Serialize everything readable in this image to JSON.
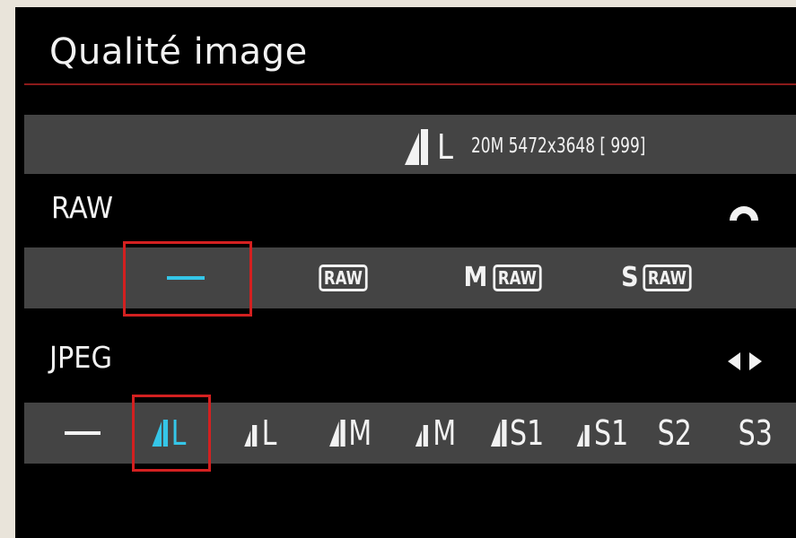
{
  "title": "Qualité image",
  "info": {
    "quality_icon": "fine-quality-icon",
    "size": "L",
    "text": "20M 5472x3648 [ 999]"
  },
  "raw": {
    "label": "RAW",
    "control_icon": "main-dial-icon",
    "options": [
      {
        "label": "—",
        "selected": true
      },
      {
        "label": "RAW",
        "prefix": ""
      },
      {
        "label": "RAW",
        "prefix": "M"
      },
      {
        "label": "RAW",
        "prefix": "S"
      }
    ]
  },
  "jpeg": {
    "label": "JPEG",
    "control_icon": "left-right-arrows-icon",
    "options": [
      {
        "label": "—"
      },
      {
        "label": "L",
        "icon": "fine-quality-icon",
        "selected": true
      },
      {
        "label": "L",
        "icon": "normal-quality-icon"
      },
      {
        "label": "M",
        "icon": "fine-quality-icon"
      },
      {
        "label": "M",
        "icon": "normal-quality-icon"
      },
      {
        "label": "S1",
        "icon": "fine-quality-icon"
      },
      {
        "label": "S1",
        "icon": "normal-quality-icon"
      },
      {
        "label": "S2"
      },
      {
        "label": "S3"
      }
    ]
  },
  "colors": {
    "background": "#000000",
    "bar": "#444444",
    "selection_border": "#d32020",
    "selected_accent": "#35c6e8",
    "title_rule": "#8c1a1a"
  }
}
